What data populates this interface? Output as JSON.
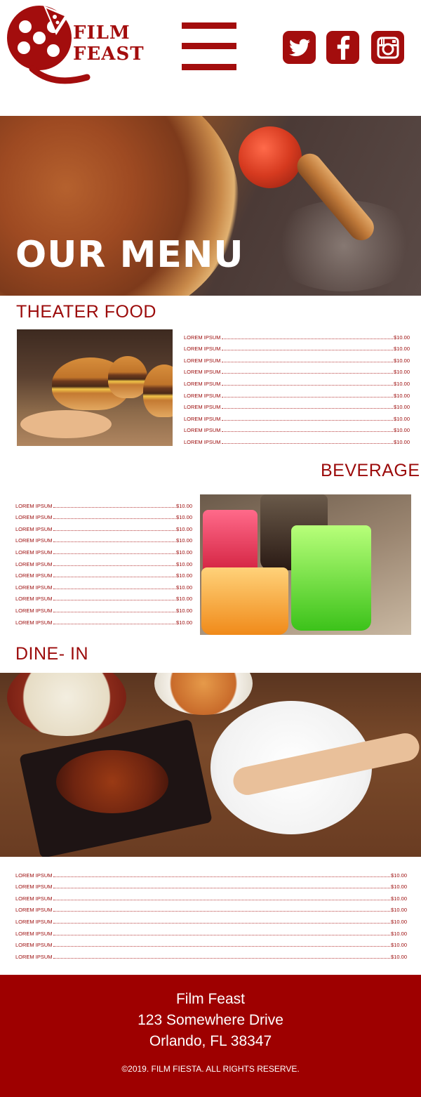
{
  "brand": {
    "line1": "FILM",
    "line2": "FEAST"
  },
  "colors": {
    "accent": "#9e0000",
    "text_red": "#9b0a0a"
  },
  "icons": {
    "menu": "hamburger-icon",
    "twitter": "twitter-icon",
    "facebook": "facebook-icon",
    "instagram": "instagram-icon"
  },
  "hero": {
    "title": "OUR MENU"
  },
  "sections": {
    "theater_food": {
      "title": "THEATER FOOD",
      "items": [
        {
          "name": "LOREM IPSUM",
          "price": "$10.00"
        },
        {
          "name": "LOREM IPSUM",
          "price": "$10.00"
        },
        {
          "name": "LOREM IPSUM",
          "price": "$10.00"
        },
        {
          "name": "LOREM IPSUM",
          "price": "$10.00"
        },
        {
          "name": "LOREM IPSUM",
          "price": "$10.00"
        },
        {
          "name": "LOREM IPSUM",
          "price": "$10.00"
        },
        {
          "name": "LOREM IPSUM",
          "price": "$10.00"
        },
        {
          "name": "LOREM IPSUM",
          "price": "$10.00"
        },
        {
          "name": "LOREM IPSUM",
          "price": "$10.00"
        },
        {
          "name": "LOREM IPSUM",
          "price": "$10.00"
        }
      ]
    },
    "beverage": {
      "title": "BEVERAGE",
      "items": [
        {
          "name": "LOREM IPSUM",
          "price": "$10.00"
        },
        {
          "name": "LOREM IPSUM",
          "price": "$10.00"
        },
        {
          "name": "LOREM IPSUM",
          "price": "$10.00"
        },
        {
          "name": "LOREM IPSUM",
          "price": "$10.00"
        },
        {
          "name": "LOREM IPSUM",
          "price": "$10.00"
        },
        {
          "name": "LOREM IPSUM",
          "price": "$10.00"
        },
        {
          "name": "LOREM IPSUM",
          "price": "$10.00"
        },
        {
          "name": "LOREM IPSUM",
          "price": "$10.00"
        },
        {
          "name": "LOREM IPSUM",
          "price": "$10.00"
        },
        {
          "name": "LOREM IPSUM",
          "price": "$10.00"
        },
        {
          "name": "LOREM IPSUM",
          "price": "$10.00"
        }
      ]
    },
    "dine_in": {
      "title": "DINE- IN",
      "items": [
        {
          "name": "LOREM IPSUM",
          "price": "$10.00"
        },
        {
          "name": "LOREM IPSUM",
          "price": "$10.00"
        },
        {
          "name": "LOREM IPSUM",
          "price": "$10.00"
        },
        {
          "name": "LOREM IPSUM",
          "price": "$10.00"
        },
        {
          "name": "LOREM IPSUM",
          "price": "$10.00"
        },
        {
          "name": "LOREM IPSUM",
          "price": "$10.00"
        },
        {
          "name": "LOREM IPSUM",
          "price": "$10.00"
        },
        {
          "name": "LOREM IPSUM",
          "price": "$10.00"
        }
      ]
    }
  },
  "footer": {
    "name": "Film Feast",
    "address1": "123 Somewhere Drive",
    "address2": "Orlando, FL 38347",
    "copyright": "©2019. FILM FIESTA. ALL RIGHTS RESERVE."
  }
}
